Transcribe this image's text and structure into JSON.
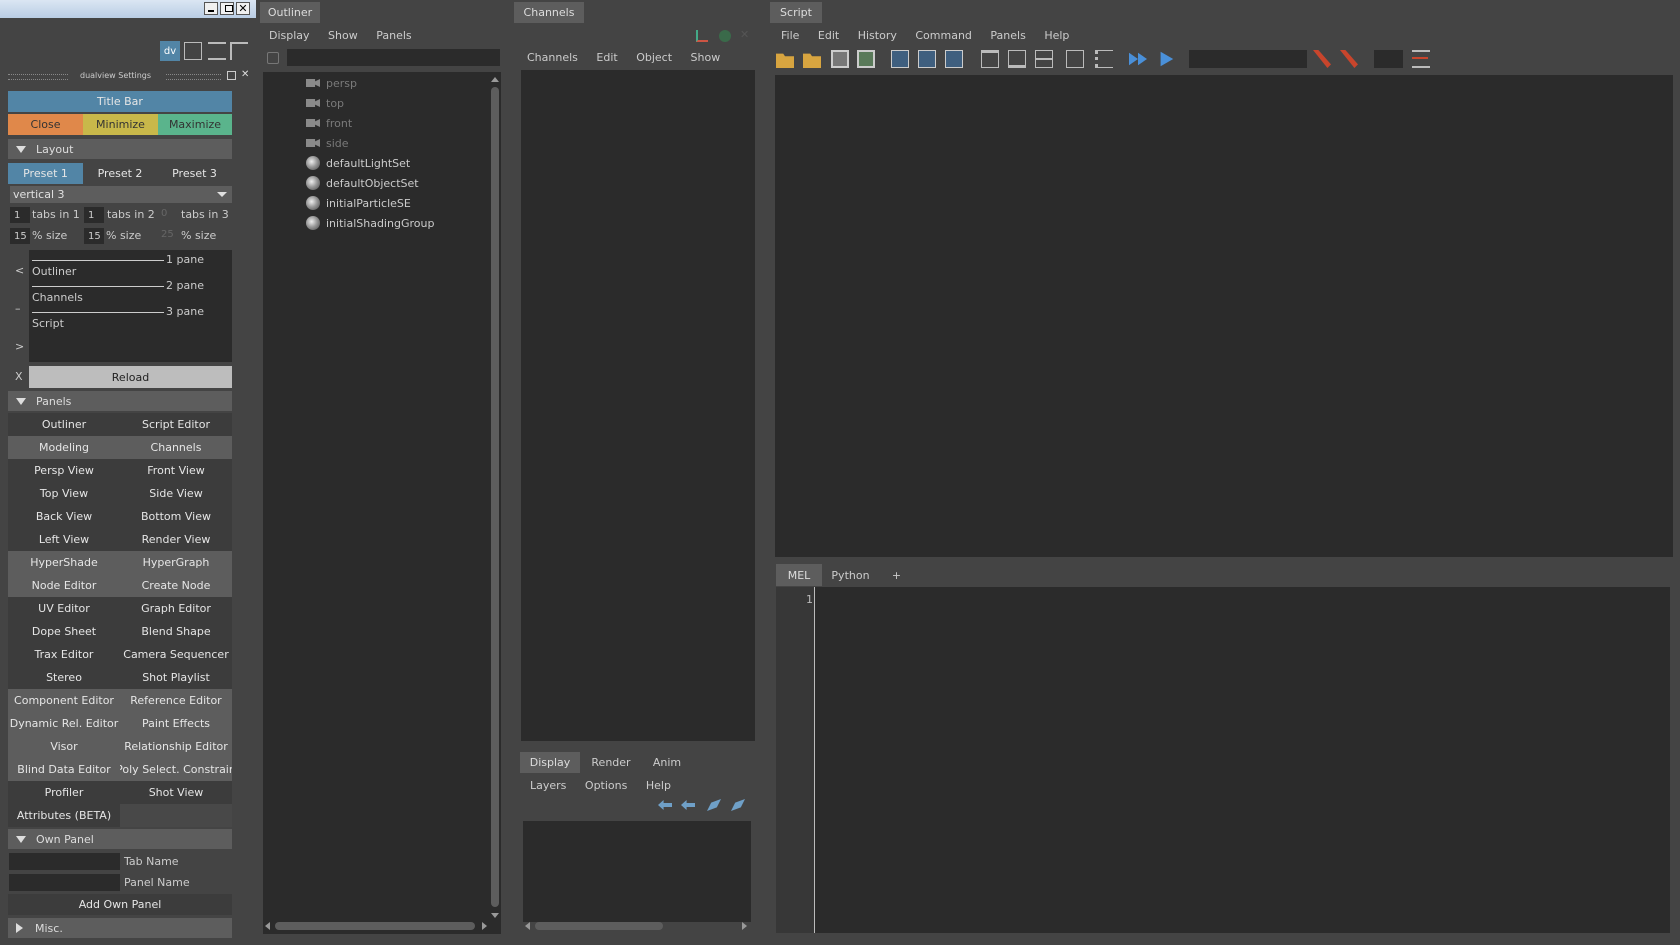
{
  "left": {
    "dv_label": "dv",
    "settings_title": "dualview Settings",
    "title_bar": "Title Bar",
    "close": "Close",
    "minimize": "Minimize",
    "maximize": "Maximize",
    "layout_section": "Layout",
    "presets": [
      "Preset 1",
      "Preset 2",
      "Preset 3"
    ],
    "layout_value": "vertical 3",
    "tabs": [
      {
        "num": "1",
        "label": "tabs in 1"
      },
      {
        "num": "1",
        "label": "tabs in 2"
      },
      {
        "num": "0",
        "label": "tabs in 3"
      }
    ],
    "sizes": [
      {
        "num": "15",
        "label": "% size"
      },
      {
        "num": "15",
        "label": "% size"
      },
      {
        "num": "25",
        "label": "% size"
      }
    ],
    "pane_labels": [
      "1 pane",
      "2 pane",
      "3 pane"
    ],
    "pane_items": [
      "Outliner",
      "Channels",
      "Script"
    ],
    "arrows": [
      "<",
      "–",
      ">"
    ],
    "x_label": "X",
    "reload": "Reload",
    "panels_section": "Panels",
    "panel_buttons": [
      [
        "Outliner",
        "Script Editor"
      ],
      [
        "Modeling",
        "Channels"
      ],
      [
        "Persp View",
        "Front View"
      ],
      [
        "Top View",
        "Side View"
      ],
      [
        "Back View",
        "Bottom View"
      ],
      [
        "Left View",
        "Render View"
      ],
      [
        "HyperShade",
        "HyperGraph"
      ],
      [
        "Node Editor",
        "Create Node"
      ],
      [
        "UV Editor",
        "Graph Editor"
      ],
      [
        "Dope Sheet",
        "Blend Shape"
      ],
      [
        "Trax Editor",
        "Camera Sequencer"
      ],
      [
        "Stereo",
        "Shot Playlist"
      ],
      [
        "Component Editor",
        "Reference Editor"
      ],
      [
        "Dynamic Rel. Editor",
        "Paint Effects"
      ],
      [
        "Visor",
        "Relationship Editor"
      ],
      [
        "Blind Data Editor",
        "Poly Select. Constrain"
      ],
      [
        "Profiler",
        "Shot View"
      ],
      [
        "Attributes (BETA)",
        ""
      ]
    ],
    "own_panel_section": "Own Panel",
    "tab_name_label": "Tab Name",
    "panel_name_label": "Panel Name",
    "add_own_panel": "Add Own Panel",
    "misc_section": "Misc."
  },
  "outliner": {
    "tab": "Outliner",
    "menu": [
      "Display",
      "Show",
      "Panels"
    ],
    "items": [
      {
        "name": "persp",
        "kind": "camera",
        "dim": true
      },
      {
        "name": "top",
        "kind": "camera",
        "dim": true
      },
      {
        "name": "front",
        "kind": "camera",
        "dim": true
      },
      {
        "name": "side",
        "kind": "camera",
        "dim": true
      },
      {
        "name": "defaultLightSet",
        "kind": "set",
        "dim": false
      },
      {
        "name": "defaultObjectSet",
        "kind": "set",
        "dim": false
      },
      {
        "name": "initialParticleSE",
        "kind": "set",
        "dim": false
      },
      {
        "name": "initialShadingGroup",
        "kind": "set",
        "dim": false
      }
    ]
  },
  "channels": {
    "tab": "Channels",
    "menu": [
      "Channels",
      "Edit",
      "Object",
      "Show"
    ],
    "layer_tabs": [
      "Display",
      "Render",
      "Anim"
    ],
    "layer_menu": [
      "Layers",
      "Options",
      "Help"
    ]
  },
  "script": {
    "tab": "Script",
    "menu": [
      "File",
      "Edit",
      "History",
      "Command",
      "Panels",
      "Help"
    ],
    "lang_tabs": [
      "MEL",
      "Python",
      "+"
    ],
    "line_number": "1"
  },
  "colors": {
    "blue": "#5285a6",
    "orange": "#e0884a",
    "yellow": "#c8b84a",
    "green": "#5ab48c",
    "panel_light": "#5d5d5d",
    "dark": "#2b2b2b"
  }
}
